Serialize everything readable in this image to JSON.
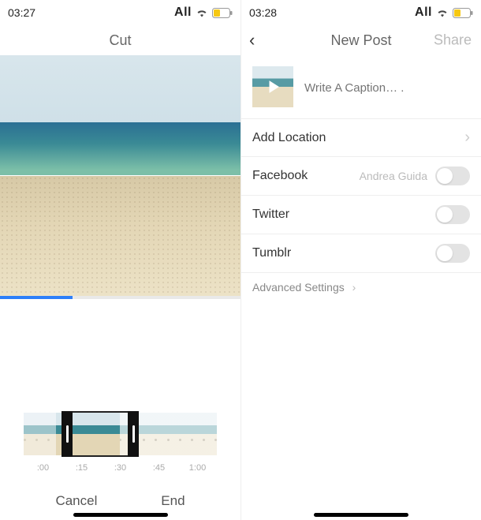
{
  "left": {
    "status": {
      "time": "03:27",
      "carrier": "All"
    },
    "nav": {
      "title": "Cut"
    },
    "progress": {
      "percent": 30
    },
    "timeline": {
      "ticks": [
        ":00",
        ":15",
        ":30",
        ":45",
        "1:00"
      ],
      "trim_start_tick": ":15",
      "trim_end_tick": ":30"
    },
    "actions": {
      "cancel": "Cancel",
      "end": "End"
    }
  },
  "right": {
    "status": {
      "time": "03:28",
      "carrier": "All"
    },
    "nav": {
      "title": "New Post",
      "share": "Share"
    },
    "caption": {
      "placeholder": "Write A Caption… ."
    },
    "rows": {
      "location": {
        "label": "Add Location"
      },
      "facebook": {
        "label": "Facebook",
        "account": "Andrea Guida",
        "on": false
      },
      "twitter": {
        "label": "Twitter",
        "on": false
      },
      "tumblr": {
        "label": "Tumblr",
        "on": false
      },
      "advanced": {
        "label": "Advanced Settings"
      }
    }
  },
  "icons": {
    "wifi": "wifi-icon",
    "battery": "battery-icon",
    "back": "chevron-left-icon",
    "chevron_right": "chevron-right-icon",
    "play": "play-icon"
  },
  "colors": {
    "progress": "#2d7ff9",
    "battery_fill": "#f6c813"
  }
}
